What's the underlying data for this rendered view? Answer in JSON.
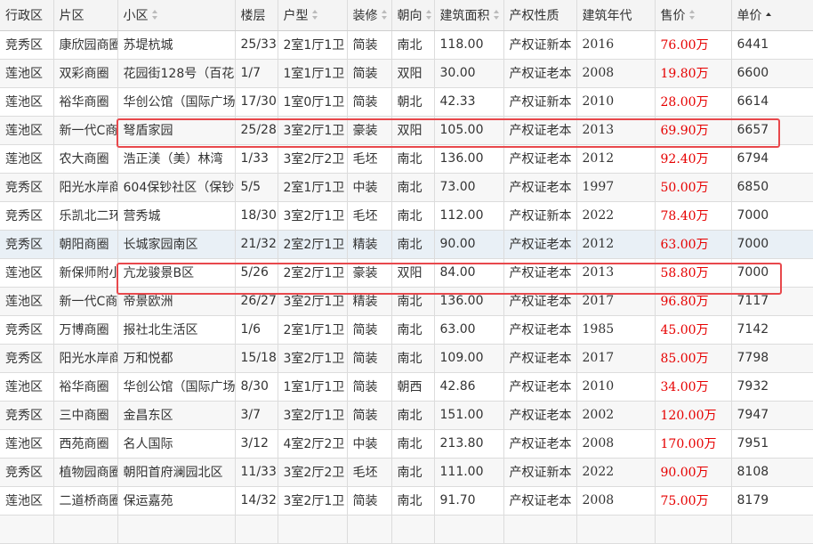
{
  "columns": [
    {
      "label": "行政区",
      "sortable": false
    },
    {
      "label": "片区",
      "sortable": false
    },
    {
      "label": "小区",
      "sortable": true
    },
    {
      "label": "楼层",
      "sortable": false
    },
    {
      "label": "户型",
      "sortable": true
    },
    {
      "label": "装修",
      "sortable": true
    },
    {
      "label": "朝向",
      "sortable": true
    },
    {
      "label": "建筑面积",
      "sortable": true
    },
    {
      "label": "产权性质",
      "sortable": false
    },
    {
      "label": "建筑年代",
      "sortable": false
    },
    {
      "label": "售价",
      "sortable": true
    },
    {
      "label": "单价",
      "sortable": true,
      "sort": "asc"
    }
  ],
  "rows": [
    [
      "竞秀区",
      "康欣园商圈",
      "苏堤杭城",
      "25/33",
      "2室1厅1卫",
      "简装",
      "南北",
      "118.00",
      "产权证新本",
      "2016",
      "76.00万",
      "6441"
    ],
    [
      "莲池区",
      "双彩商圈",
      "花园街128号（百花",
      "1/7",
      "1室1厅1卫",
      "简装",
      "双阳",
      "30.00",
      "产权证老本",
      "2008",
      "19.80万",
      "6600"
    ],
    [
      "莲池区",
      "裕华商圈",
      "华创公馆（国际广场",
      "17/30",
      "1室0厅1卫",
      "简装",
      "朝北",
      "42.33",
      "产权证新本",
      "2010",
      "28.00万",
      "6614"
    ],
    [
      "莲池区",
      "新一代C商圈",
      "弩盾家园",
      "25/28",
      "3室2厅1卫",
      "豪装",
      "双阳",
      "105.00",
      "产权证老本",
      "2013",
      "69.90万",
      "6657"
    ],
    [
      "莲池区",
      "农大商圈",
      "浩正渼（美）林湾",
      "1/33",
      "3室2厅2卫",
      "毛坯",
      "南北",
      "136.00",
      "产权证老本",
      "2012",
      "92.40万",
      "6794"
    ],
    [
      "竞秀区",
      "阳光水岸商圈",
      "604保钞社区（保钞",
      "5/5",
      "2室1厅1卫",
      "中装",
      "南北",
      "73.00",
      "产权证老本",
      "1997",
      "50.00万",
      "6850"
    ],
    [
      "竞秀区",
      "乐凯北二环",
      "营秀城",
      "18/30",
      "3室2厅1卫",
      "毛坯",
      "南北",
      "112.00",
      "产权证新本",
      "2022",
      "78.40万",
      "7000"
    ],
    [
      "竞秀区",
      "朝阳商圈",
      "长城家园南区",
      "21/32",
      "2室2厅1卫",
      "精装",
      "南北",
      "90.00",
      "产权证老本",
      "2012",
      "63.00万",
      "7000"
    ],
    [
      "莲池区",
      "新保师附小",
      "亢龙骏景B区",
      "5/26",
      "2室2厅1卫",
      "豪装",
      "双阳",
      "84.00",
      "产权证老本",
      "2013",
      "58.80万",
      "7000"
    ],
    [
      "莲池区",
      "新一代C商圈",
      "帝景欧洲",
      "26/27",
      "3室2厅1卫",
      "精装",
      "南北",
      "136.00",
      "产权证老本",
      "2017",
      "96.80万",
      "7117"
    ],
    [
      "竞秀区",
      "万博商圈",
      "报社北生活区",
      "1/6",
      "2室1厅1卫",
      "简装",
      "南北",
      "63.00",
      "产权证老本",
      "1985",
      "45.00万",
      "7142"
    ],
    [
      "竞秀区",
      "阳光水岸商圈",
      "万和悦都",
      "15/18",
      "3室2厅1卫",
      "简装",
      "南北",
      "109.00",
      "产权证老本",
      "2017",
      "85.00万",
      "7798"
    ],
    [
      "莲池区",
      "裕华商圈",
      "华创公馆（国际广场",
      "8/30",
      "1室1厅1卫",
      "简装",
      "朝西",
      "42.86",
      "产权证老本",
      "2010",
      "34.00万",
      "7932"
    ],
    [
      "竞秀区",
      "三中商圈",
      "金昌东区",
      "3/7",
      "3室2厅1卫",
      "简装",
      "南北",
      "151.00",
      "产权证老本",
      "2002",
      "120.00万",
      "7947"
    ],
    [
      "莲池区",
      "西苑商圈",
      "名人国际",
      "3/12",
      "4室2厅2卫",
      "中装",
      "南北",
      "213.80",
      "产权证老本",
      "2008",
      "170.00万",
      "7951"
    ],
    [
      "竞秀区",
      "植物园商圈",
      "朝阳首府澜园北区",
      "11/33",
      "3室2厅2卫",
      "毛坯",
      "南北",
      "111.00",
      "产权证新本",
      "2022",
      "90.00万",
      "8108"
    ],
    [
      "莲池区",
      "二道桥商圈",
      "保运嘉苑",
      "14/32",
      "3室2厅1卫",
      "简装",
      "南北",
      "91.70",
      "产权证老本",
      "2008",
      "75.00万",
      "8179"
    ],
    [
      "",
      "",
      "",
      "",
      "",
      "",
      "",
      "",
      "",
      "",
      "",
      ""
    ]
  ]
}
